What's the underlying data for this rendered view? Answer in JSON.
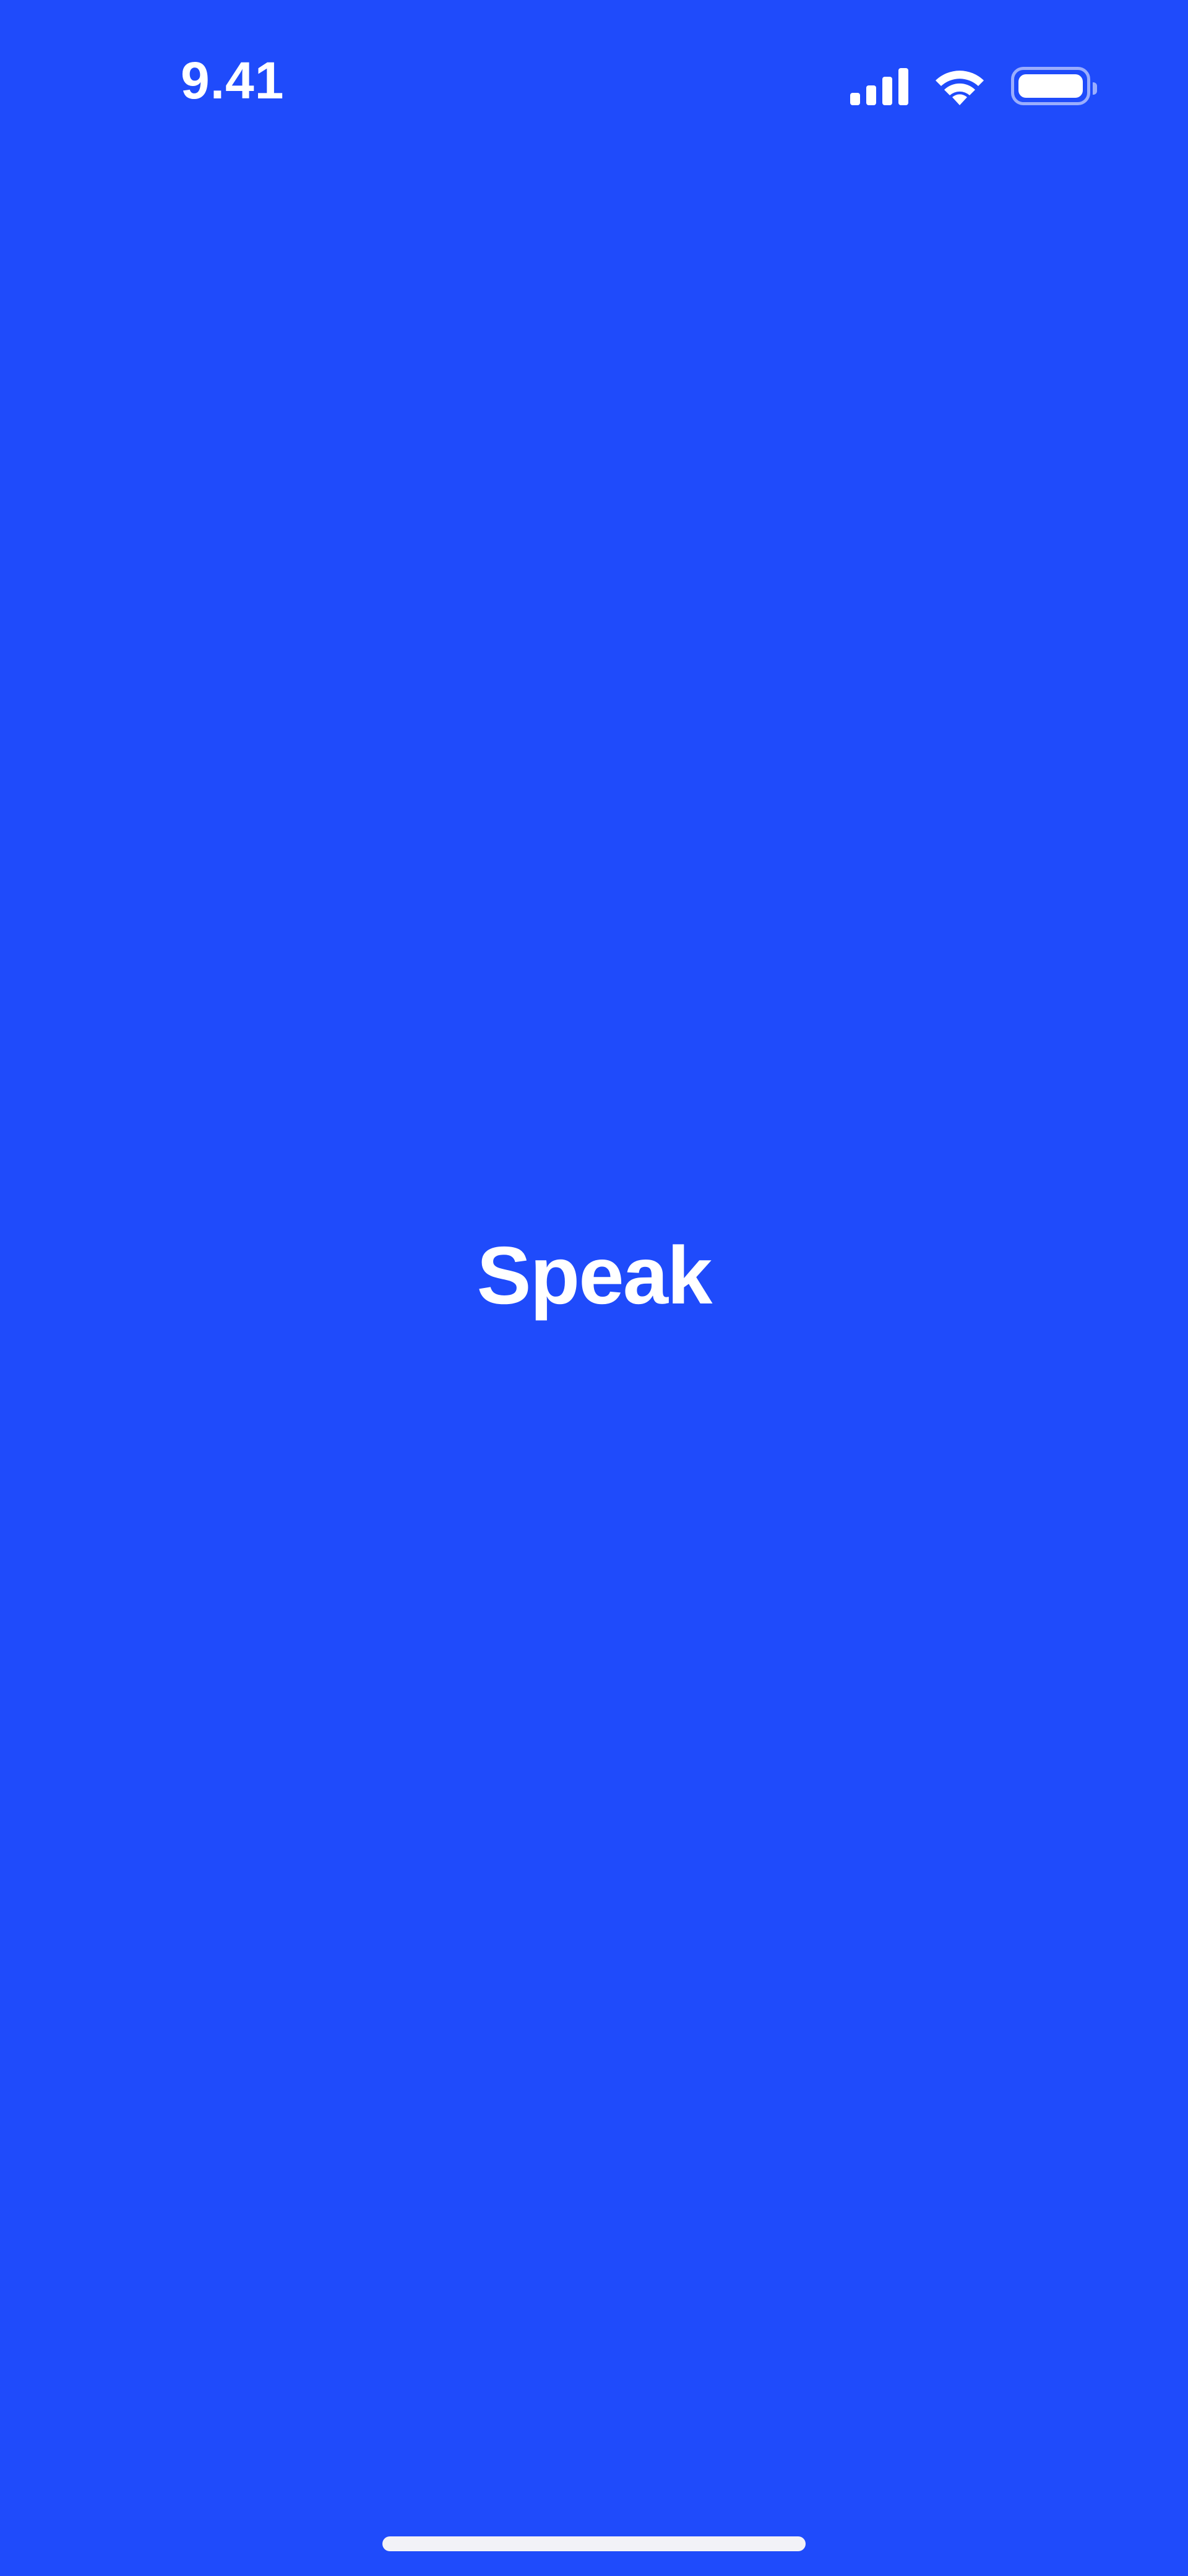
{
  "status_bar": {
    "time": "9.41",
    "icons": [
      "cellular-signal-icon",
      "wifi-icon",
      "battery-icon"
    ]
  },
  "splash": {
    "app_name": "Speak"
  },
  "colors": {
    "background": "#1f4bfb",
    "foreground": "#ffffff",
    "home_indicator": "#f2f2f7"
  }
}
